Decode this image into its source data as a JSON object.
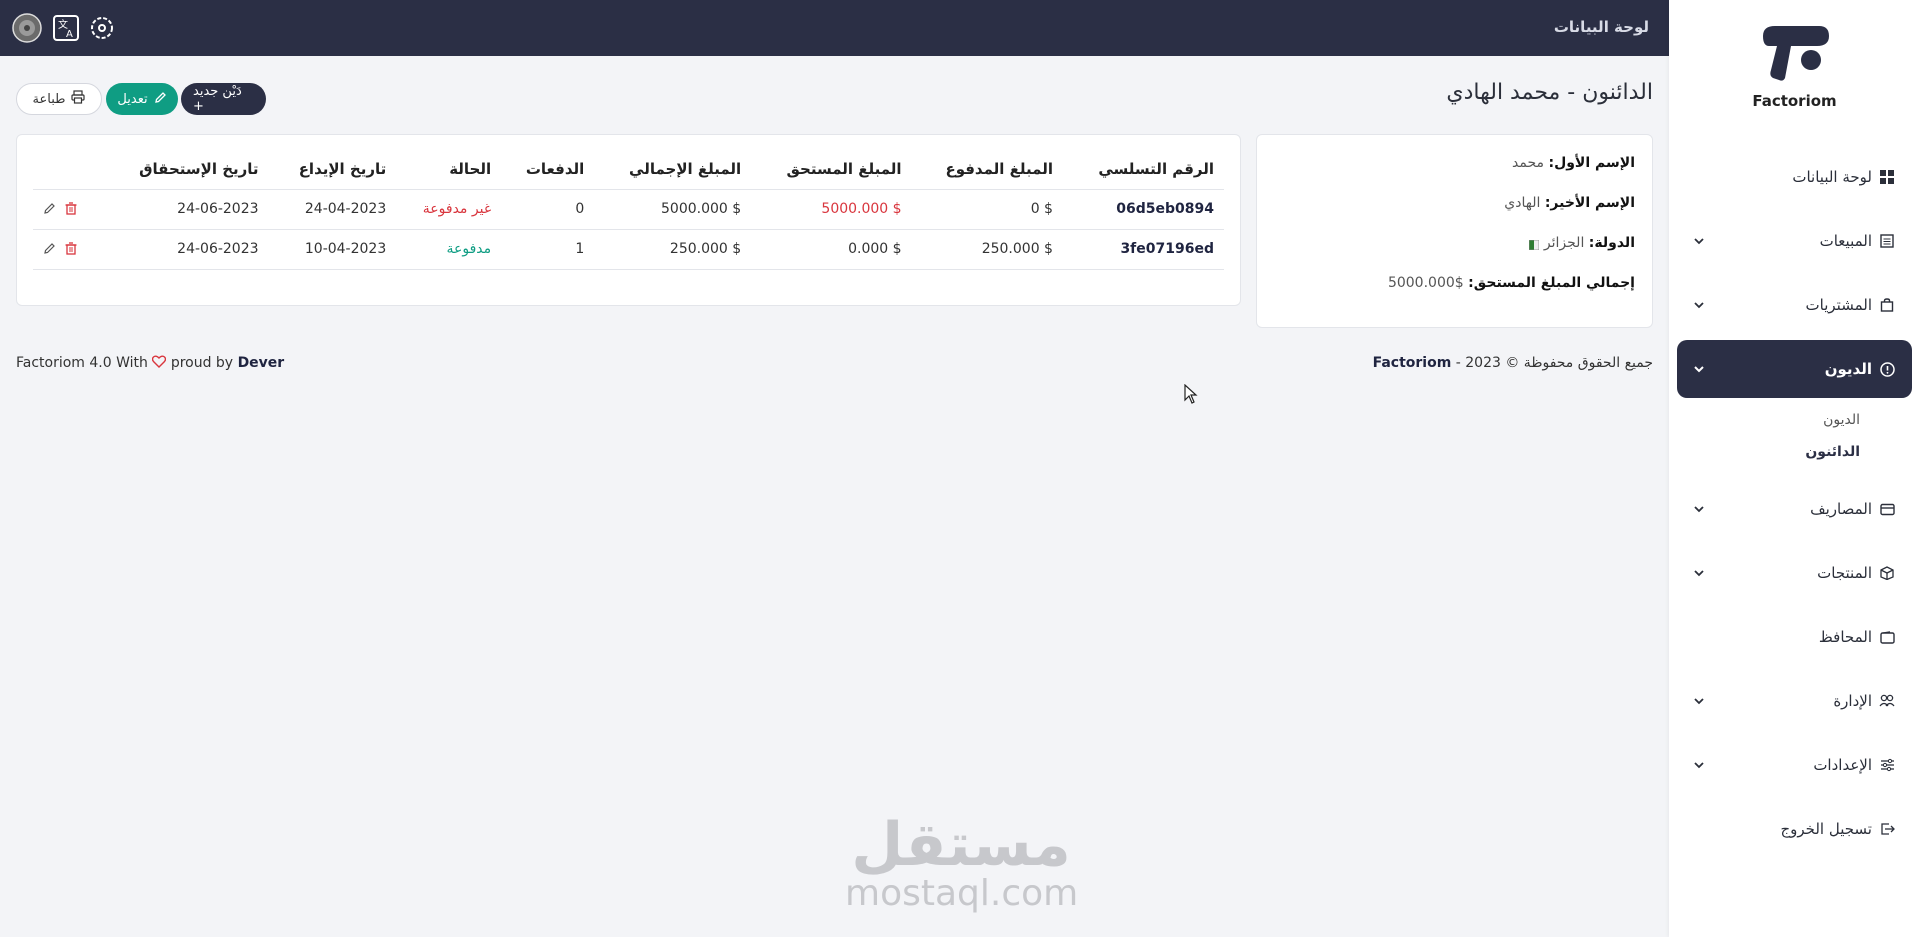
{
  "topbar": {
    "title": "لوحة البيانات",
    "icons": [
      "avatar",
      "translate-icon",
      "settings-icon"
    ]
  },
  "brand": {
    "name": "Factoriom"
  },
  "sidebar": {
    "items": [
      {
        "label": "لوحة البيانات",
        "icon": "grid-icon",
        "has_chevron": false
      },
      {
        "label": "المبيعات",
        "icon": "receipt-icon",
        "has_chevron": true
      },
      {
        "label": "المشتريات",
        "icon": "bag-icon",
        "has_chevron": true
      },
      {
        "label": "الديون",
        "icon": "alert-circle-icon",
        "has_chevron": true,
        "active": true
      },
      {
        "label": "المصاريف",
        "icon": "card-icon",
        "has_chevron": true
      },
      {
        "label": "المنتجات",
        "icon": "box-icon",
        "has_chevron": true
      },
      {
        "label": "المحافظ",
        "icon": "wallet-icon",
        "has_chevron": false
      },
      {
        "label": "الإدارة",
        "icon": "users-icon",
        "has_chevron": true
      },
      {
        "label": "الإعدادات",
        "icon": "sliders-icon",
        "has_chevron": true
      },
      {
        "label": "تسجيل الخروج",
        "icon": "logout-icon",
        "has_chevron": false
      }
    ],
    "sub_items": [
      "الديون",
      "الدائنون"
    ]
  },
  "page": {
    "title": "الدائنون - محمد الهادي",
    "buttons": {
      "new": "دَيْن جديد +",
      "edit": "تعديل",
      "print": "طباعة"
    }
  },
  "info": {
    "first_name_label": "الإسم الأول:",
    "first_name": "محمد",
    "last_name_label": "الإسم الأخير:",
    "last_name": "الهادي",
    "country_label": "الدولة:",
    "country": "الجزائر",
    "total_due_label": "إجمالي المبلغ المستحق:",
    "total_due": "$5000.000"
  },
  "table": {
    "headers": [
      "الرقم التسلسي",
      "المبلغ المدفوع",
      "المبلغ المستحق",
      "المبلغ الإجمالي",
      "الدفعات",
      "الحالة",
      "تاريخ الإيداع",
      "تاريخ الإستحقاق"
    ],
    "rows": [
      {
        "serial": "06d5eb0894",
        "paid": "$ 0",
        "due": "$ 5000.000",
        "total": "$ 5000.000",
        "payments": "0",
        "status": "غير مدفوعة",
        "deposit_date": "24-04-2023",
        "due_date": "24-06-2023"
      },
      {
        "serial": "3fe07196ed",
        "paid": "$ 250.000",
        "due": "$ 0.000",
        "total": "$ 250.000",
        "payments": "1",
        "status": "مدفوعة",
        "deposit_date": "10-04-2023",
        "due_date": "24-06-2023"
      }
    ]
  },
  "footer": {
    "rights_prefix": "جميع الحقوق محفوظة © 2023 -",
    "rights_brand": "Factoriom",
    "left_prefix": "Factoriom 4.0 With",
    "left_mid": "proud by",
    "left_brand": "Dever"
  },
  "watermark": {
    "arabic": "مستقل",
    "latin": "mostaql.com"
  },
  "colors": {
    "dark": "#2b2f45",
    "accent_green": "#0f9d83",
    "danger": "#d9363e",
    "background": "#f3f4f7"
  }
}
